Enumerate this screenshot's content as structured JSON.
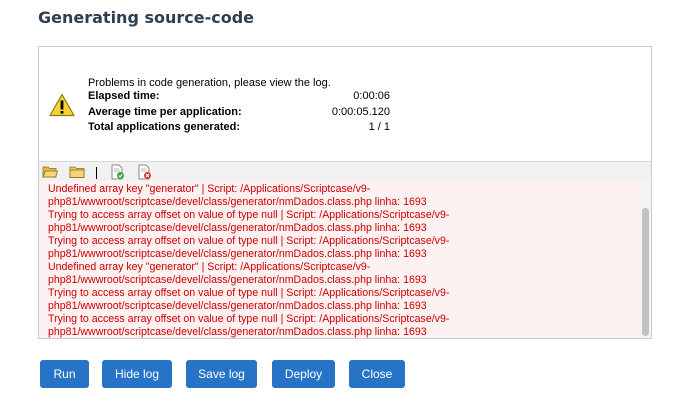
{
  "page": {
    "title": "Generating source-code"
  },
  "summary": {
    "message": "Problems in code generation, please view the log.",
    "stats": [
      {
        "label": "Elapsed time:",
        "value": "0:00:06"
      },
      {
        "label": "Average time per application:",
        "value": "0:00:05.120"
      },
      {
        "label": "Total applications generated:",
        "value": "1 / 1"
      }
    ]
  },
  "toolbar": {
    "icons": [
      "open-folder-icon",
      "folder-icon",
      "document-check-icon",
      "document-delete-icon"
    ]
  },
  "log": {
    "lines": [
      "Undefined array key \"generator\" | Script: /Applications/Scriptcase/v9-",
      "php81/wwwroot/scriptcase/devel/class/generator/nmDados.class.php linha: 1693",
      "Trying to access array offset on value of type null | Script: /Applications/Scriptcase/v9-",
      "php81/wwwroot/scriptcase/devel/class/generator/nmDados.class.php linha: 1693",
      "Trying to access array offset on value of type null | Script: /Applications/Scriptcase/v9-",
      "php81/wwwroot/scriptcase/devel/class/generator/nmDados.class.php linha: 1693",
      "Undefined array key \"generator\" | Script: /Applications/Scriptcase/v9-",
      "php81/wwwroot/scriptcase/devel/class/generator/nmDados.class.php linha: 1693",
      "Trying to access array offset on value of type null | Script: /Applications/Scriptcase/v9-",
      "php81/wwwroot/scriptcase/devel/class/generator/nmDados.class.php linha: 1693",
      "Trying to access array offset on value of type null | Script: /Applications/Scriptcase/v9-",
      "php81/wwwroot/scriptcase/devel/class/generator/nmDados.class.php linha: 1693"
    ],
    "text_color": "#cc0000",
    "background": "#fdf1f2"
  },
  "buttons": {
    "run": "Run",
    "hide_log": "Hide log",
    "save_log": "Save log",
    "deploy": "Deploy",
    "close": "Close"
  },
  "colors": {
    "button": "#2774c7",
    "title": "#2f3e4e"
  }
}
